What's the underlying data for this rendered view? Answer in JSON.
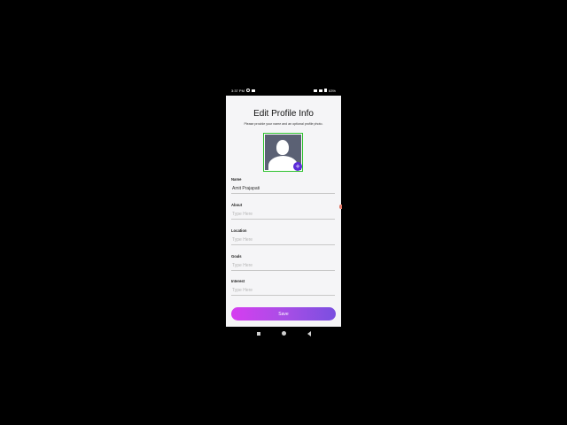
{
  "status_bar": {
    "time": "3:37 PM",
    "battery": "63%"
  },
  "header": {
    "title": "Edit Profile Info",
    "subtitle": "Please provide your name and an optional profile photo."
  },
  "avatar": {
    "add_icon": "plus-icon",
    "glyph": "+"
  },
  "fields": {
    "name": {
      "label": "Name",
      "value": "Amit Prajapati",
      "placeholder": ""
    },
    "about": {
      "label": "About",
      "value": "",
      "placeholder": "Type Here"
    },
    "location": {
      "label": "Location",
      "value": "",
      "placeholder": "Type Here"
    },
    "goals": {
      "label": "Goals",
      "value": "",
      "placeholder": "Type Here"
    },
    "interest": {
      "label": "Interest",
      "value": "",
      "placeholder": "Type Here"
    }
  },
  "save_button": {
    "label": "Save"
  },
  "colors": {
    "avatar_border": "#2fc22f",
    "add_badge": "#5b2bd8",
    "save_gradient_start": "#d63df0",
    "save_gradient_end": "#7a4fe0"
  },
  "nav": {
    "icons": [
      "recents-square-icon",
      "home-circle-icon",
      "back-triangle-icon"
    ]
  }
}
